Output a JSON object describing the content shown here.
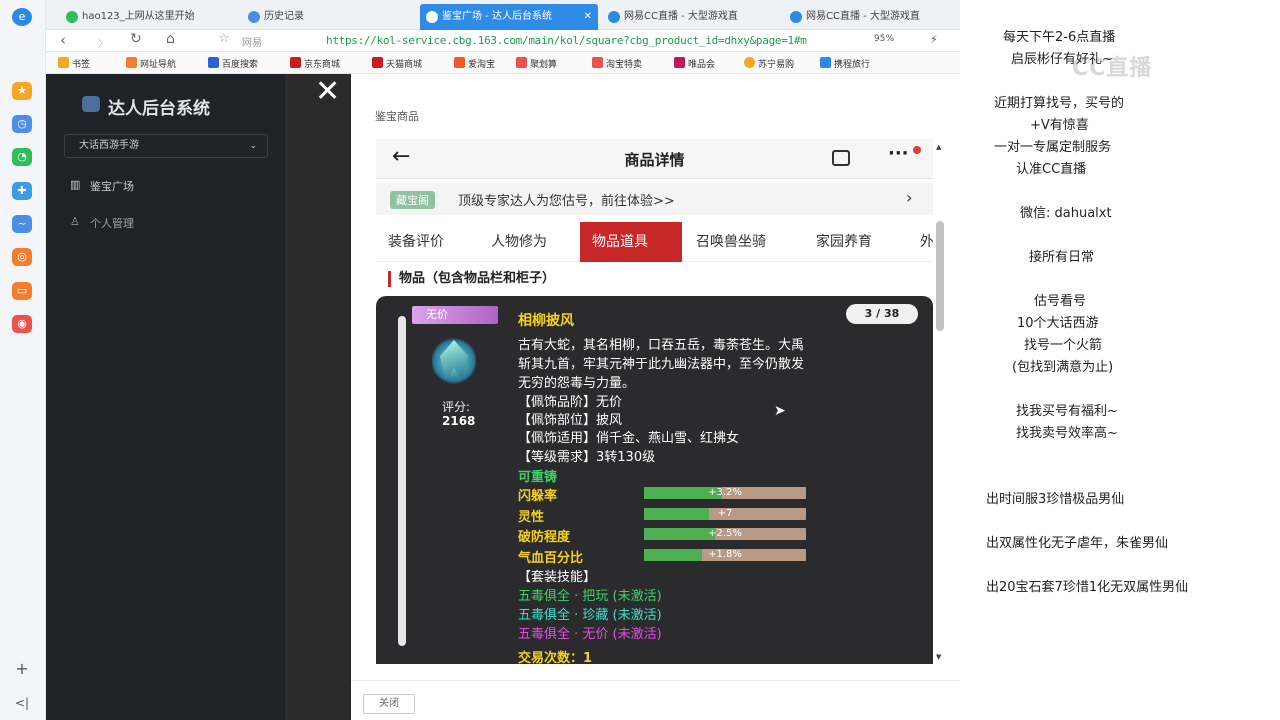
{
  "browser": {
    "tabs": [
      {
        "label": "hao123_上网从这里开始"
      },
      {
        "label": "历史记录"
      },
      {
        "label": "鉴宝广场 - 达人后台系统"
      },
      {
        "label": "网易CC直播 - 大型游戏直"
      },
      {
        "label": "网易CC直播 - 大型游戏直"
      }
    ],
    "site_label": "网易",
    "url": "https://kol-service.cbg.163.com/main/kol/square?cbg_product_id=dhxy&page=1#m",
    "zoom": "95%",
    "bookmarks": [
      "书签",
      "网址导航",
      "百度搜索",
      "京东商城",
      "天猫商城",
      "爱淘宝",
      "聚划算",
      "淘宝特卖",
      "唯品会",
      "苏宁易购",
      "携程旅行"
    ]
  },
  "app": {
    "title": "达人后台系统",
    "game_select": "大话西游手游",
    "menu": [
      "鉴宝广场",
      "个人管理"
    ]
  },
  "modal": {
    "title": "鉴宝商品",
    "close_label": "关闭",
    "phone": {
      "header_title": "商品详情",
      "promo_badge": "藏宝阁",
      "promo_text": "顶级专家达人为您估号，前往体验>>",
      "tabs": [
        "装备评价",
        "人物修为",
        "物品道具",
        "召唤兽坐骑",
        "家园养育",
        "外"
      ],
      "active_tab": "物品道具",
      "section_title": "物品（包含物品栏和柜子）",
      "item": {
        "ribbon": "无价",
        "name": "相柳披风",
        "counter": "3 / 38",
        "score_label": "评分:",
        "score": "2168",
        "desc1": "古有大蛇，其名相柳，口吞五岳，毒荼苍生。大禹",
        "desc2": "斩其九首，牢其元神于此九幽法器中，至今仍散发",
        "desc3": "无穷的怨毒与力量。",
        "p1": "【佩饰品阶】无价",
        "p2": "【佩饰部位】披风",
        "p3": "【佩饰适用】俏千金、燕山雪、红拂女",
        "p4": "【等级需求】3转130级",
        "recast": "可重铸",
        "attrs": [
          {
            "name": "闪躲率",
            "value": "+3.2%",
            "fill": 0.48
          },
          {
            "name": "灵性",
            "value": "+7",
            "fill": 0.4
          },
          {
            "name": "破防程度",
            "value": "+2.5%",
            "fill": 0.44
          },
          {
            "name": "气血百分比",
            "value": "+1.8%",
            "fill": 0.36
          }
        ],
        "set_title": "【套装技能】",
        "set1": "五毒俱全 · 把玩 (未激活)",
        "set2": "五毒俱全 · 珍藏 (未激活)",
        "set3": "五毒俱全 · 无价 (未激活)",
        "trade": "交易次数：1"
      }
    }
  },
  "stream": {
    "lines": [
      "每天下午2-6点直播",
      "启辰彬仔有好礼~",
      "近期打算找号，买号的",
      "+V有惊喜",
      "一对一专属定制服务",
      "认准CC直播",
      "微信:   dahualxt",
      "接所有日常",
      "估号看号",
      "10个大话西游",
      "找号一个火箭",
      "(包找到满意为止)",
      "找我买号有福利~",
      "找我卖号效率高~",
      "出时间服3珍惜极品男仙",
      "出双属性化无子虐年，朱雀男仙",
      "出20宝石套7珍惜1化无双属性男仙"
    ],
    "logo": "CC直播"
  }
}
